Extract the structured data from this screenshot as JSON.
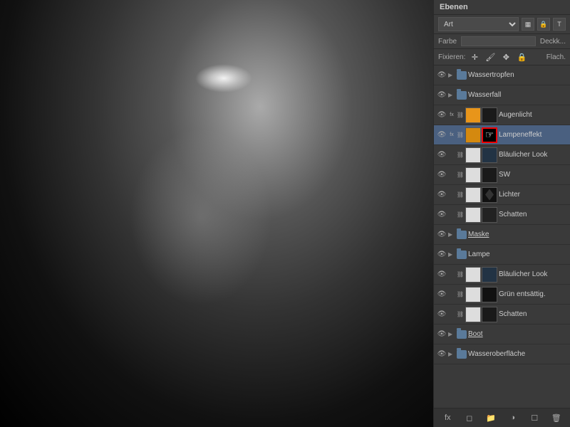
{
  "panel": {
    "title": "Ebenen",
    "mode_label": "Art",
    "color_label": "Farbe",
    "opacity_label": "Deckk...",
    "fix_label": "Fixieren:",
    "flat_label": "Flach."
  },
  "toolbar": {
    "mode": "Art",
    "icons": [
      "img",
      "lock",
      "T"
    ]
  },
  "layers": [
    {
      "id": 1,
      "name": "Wassertropfen",
      "type": "group",
      "visible": true,
      "indent": 0,
      "collapsed": true
    },
    {
      "id": 2,
      "name": "Wasserfall",
      "type": "group",
      "visible": true,
      "indent": 0,
      "collapsed": true
    },
    {
      "id": 3,
      "name": "Augenlicht",
      "type": "adjustment",
      "visible": true,
      "thumb": "orange",
      "mask": "dark",
      "active": false,
      "has_fx": true,
      "has_chain": true
    },
    {
      "id": 4,
      "name": "Lampeneffekt",
      "type": "adjustment",
      "visible": true,
      "thumb": "orange2",
      "mask": "cursor",
      "active": true,
      "has_fx": true,
      "has_chain": true
    },
    {
      "id": 5,
      "name": "Bläulicher Look",
      "type": "adjustment",
      "visible": true,
      "thumb": "white",
      "mask": "dark2",
      "active": false,
      "has_fx": false,
      "has_chain": true
    },
    {
      "id": 6,
      "name": "SW",
      "type": "adjustment",
      "visible": true,
      "thumb": "white",
      "mask": "dark",
      "active": false,
      "has_fx": false,
      "has_chain": true
    },
    {
      "id": 7,
      "name": "Lichter",
      "type": "adjustment",
      "visible": true,
      "thumb": "white",
      "mask": "dark-figure",
      "active": false,
      "has_fx": false,
      "has_chain": true
    },
    {
      "id": 8,
      "name": "Schatten",
      "type": "adjustment",
      "visible": true,
      "thumb": "white",
      "mask": "dark2",
      "active": false,
      "has_fx": false,
      "has_chain": true
    },
    {
      "id": 9,
      "name": "Maske",
      "type": "group",
      "visible": true,
      "indent": 0,
      "collapsed": true
    },
    {
      "id": 10,
      "name": "Lampe",
      "type": "group",
      "visible": true,
      "indent": 0,
      "collapsed": true
    },
    {
      "id": 11,
      "name": "Bläulicher Look",
      "type": "adjustment",
      "visible": true,
      "thumb": "white",
      "mask": "dark2",
      "active": false,
      "has_fx": false,
      "has_chain": true
    },
    {
      "id": 12,
      "name": "Grün entsättig...",
      "type": "adjustment",
      "visible": true,
      "thumb": "white",
      "mask": "dark",
      "active": false,
      "has_fx": false,
      "has_chain": true
    },
    {
      "id": 13,
      "name": "Schatten",
      "type": "adjustment",
      "visible": true,
      "thumb": "white",
      "mask": "dark-figure2",
      "active": false,
      "has_fx": false,
      "has_chain": true
    },
    {
      "id": 14,
      "name": "Boot",
      "type": "group",
      "visible": true,
      "indent": 0,
      "collapsed": true
    },
    {
      "id": 15,
      "name": "Wasseroberfläche",
      "type": "group",
      "visible": true,
      "indent": 0,
      "collapsed": true
    }
  ],
  "bottom_icons": [
    "fx",
    "mask",
    "folder",
    "adjustment",
    "trash"
  ]
}
